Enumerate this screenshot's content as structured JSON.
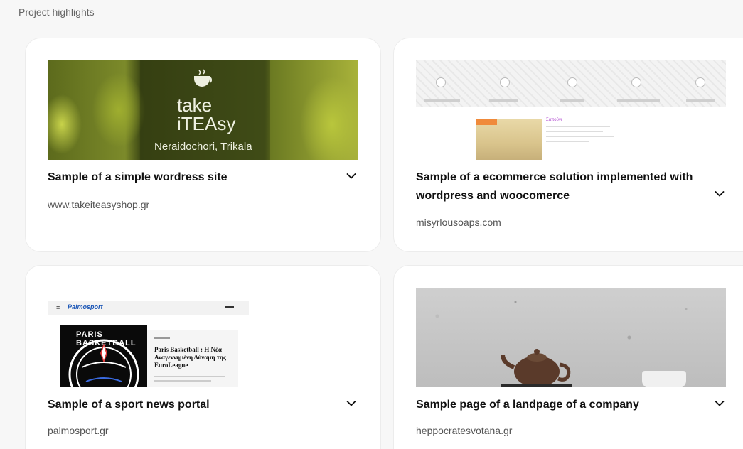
{
  "section": {
    "title": "Project highlights"
  },
  "projects": [
    {
      "title": "Sample of a simple wordress site",
      "url": "www.takeiteasyshop.gr",
      "image_text": {
        "line1": "take",
        "line2": "iTEAsy",
        "caption": "Neraidochori, Trikala"
      }
    },
    {
      "title": "Sample of a ecommerce solution implemented with wordpress and woocomerce",
      "url": "misyrlousoaps.com",
      "image_text": {
        "product_heading": "Σαπούνι"
      }
    },
    {
      "title": "Sample of a sport news portal",
      "url": "palmosport.gr",
      "image_text": {
        "logo": "Palmosport",
        "headline": "Paris Basketball : Η Νέα Αναγεννημένη Δύναμη της EuroLeague",
        "badge": "PARIS BASKETBALL"
      }
    },
    {
      "title": "Sample page of a landpage of a company",
      "url": "heppocratesvotana.gr"
    }
  ],
  "icons": {
    "expand": "chevron-down-icon"
  },
  "colors": {
    "page_bg": "#f7f7f7",
    "card_bg": "#ffffff",
    "url_text": "#555555"
  }
}
